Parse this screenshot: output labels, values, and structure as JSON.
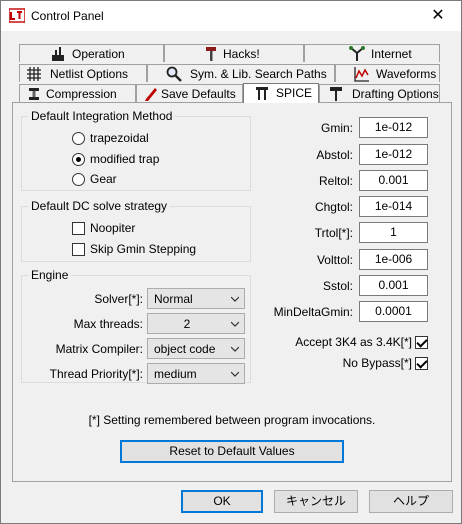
{
  "window": {
    "title": "Control Panel",
    "close_glyph": "✕"
  },
  "tabs": {
    "row1": [
      {
        "label": "Operation",
        "icon": "operation-icon"
      },
      {
        "label": "Hacks!",
        "icon": "hammer-icon"
      },
      {
        "label": "Internet",
        "icon": "network-icon"
      }
    ],
    "row2": [
      {
        "label": "Netlist Options",
        "icon": "netlist-grid-icon"
      },
      {
        "label": "Sym. & Lib. Search Paths",
        "icon": "magnifier-icon"
      },
      {
        "label": "Waveforms",
        "icon": "waveform-icon"
      }
    ],
    "row3": [
      {
        "label": "Compression",
        "icon": "compression-icon"
      },
      {
        "label": "Save Defaults",
        "icon": "pencil-icon"
      },
      {
        "label": "SPICE",
        "icon": "spice-icon"
      },
      {
        "label": "Drafting Options",
        "icon": "drafting-icon"
      }
    ],
    "active": "SPICE"
  },
  "integration": {
    "legend": "Default Integration Method",
    "options": [
      "trapezoidal",
      "modified trap",
      "Gear"
    ],
    "selected": "modified trap"
  },
  "dc": {
    "legend": "Default DC solve strategy",
    "noopiter": "Noopiter",
    "noopiter_checked": false,
    "skip_gmin": "Skip Gmin Stepping",
    "skip_gmin_checked": false
  },
  "engine": {
    "legend": "Engine",
    "solver_label": "Solver[*]:",
    "solver_value": "Normal",
    "threads_label": "Max threads:",
    "threads_value": "2",
    "compiler_label": "Matrix Compiler:",
    "compiler_value": "object code",
    "priority_label": "Thread Priority[*]:",
    "priority_value": "medium"
  },
  "tolerances": [
    {
      "label": "Gmin:",
      "value": "1e-012"
    },
    {
      "label": "Abstol:",
      "value": "1e-012"
    },
    {
      "label": "Reltol:",
      "value": "0.001"
    },
    {
      "label": "Chgtol:",
      "value": "1e-014"
    },
    {
      "label": "Trtol[*]:",
      "value": "1"
    },
    {
      "label": "Volttol:",
      "value": "1e-006"
    },
    {
      "label": "Sstol:",
      "value": "0.001"
    },
    {
      "label": "MinDeltaGmin:",
      "value": "0.0001"
    }
  ],
  "flags": {
    "accept_3k4": "Accept 3K4 as 3.4K[*]",
    "accept_3k4_checked": true,
    "no_bypass": "No Bypass[*]",
    "no_bypass_checked": true
  },
  "note": "[*] Setting remembered between program invocations.",
  "reset_button": "Reset to Default Values",
  "buttons": {
    "ok": "OK",
    "cancel": "キャンセル",
    "help": "ヘルプ"
  }
}
